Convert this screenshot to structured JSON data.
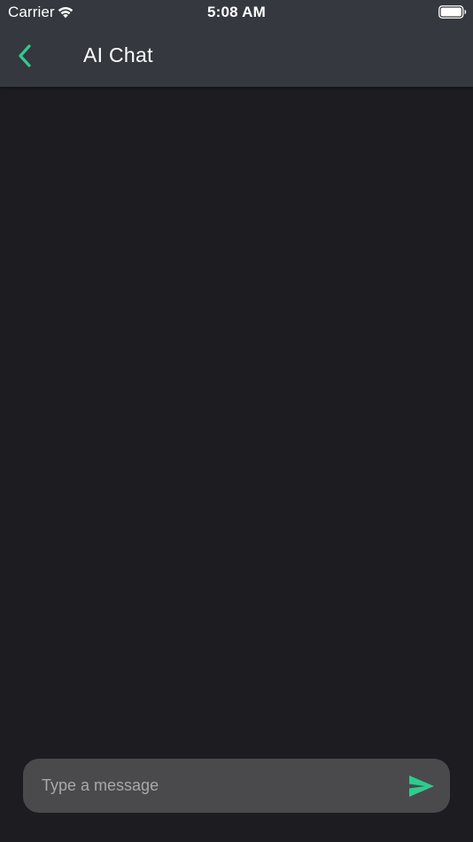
{
  "status_bar": {
    "carrier": "Carrier",
    "time": "5:08 AM",
    "wifi_icon": "wifi-icon",
    "battery_icon": "battery-icon"
  },
  "nav": {
    "back_icon": "chevron-left-icon",
    "title": "AI Chat"
  },
  "composer": {
    "placeholder": "Type a message",
    "value": "",
    "send_icon": "send-icon"
  },
  "colors": {
    "accent": "#2ecc8f",
    "header_background": "#35383f",
    "page_background": "#1c1c21",
    "input_background": "#4a4a4d",
    "placeholder_text": "#a8a8ac"
  }
}
